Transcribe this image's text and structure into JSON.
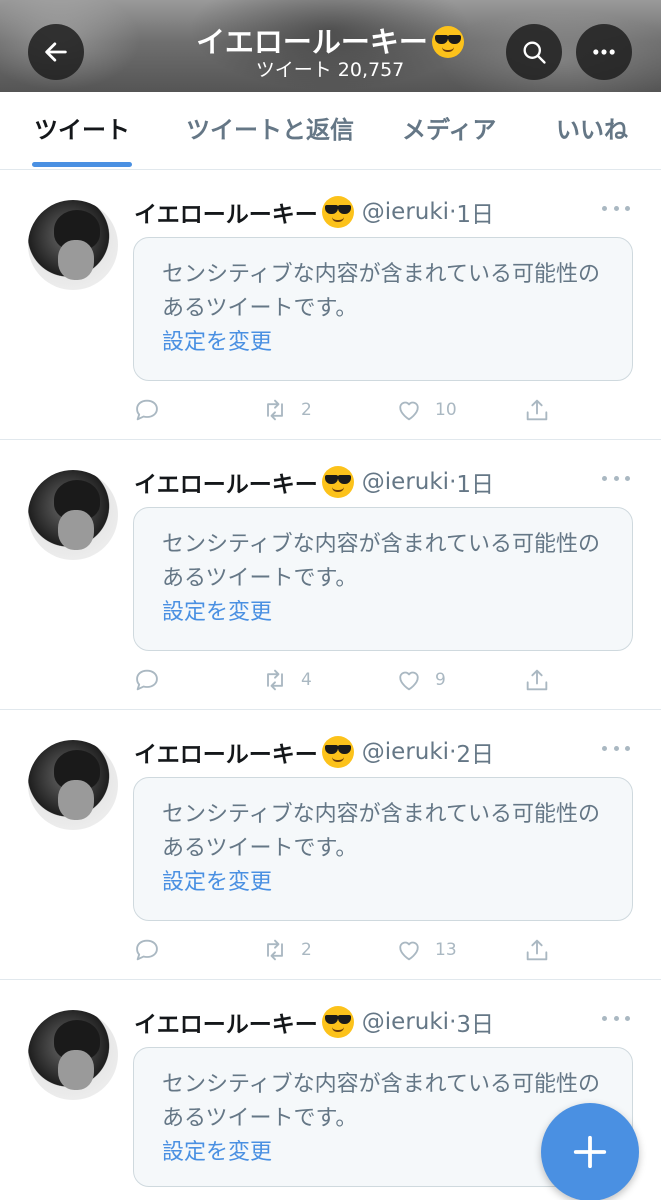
{
  "header": {
    "title": "イエロールーキー",
    "subtitle": "ツイート 20,757",
    "icons": [
      "back-arrow-icon",
      "search-icon",
      "more-icon"
    ]
  },
  "tabs": [
    {
      "label": "ツイート",
      "active": true
    },
    {
      "label": "ツイートと返信",
      "active": false
    },
    {
      "label": "メディア",
      "active": false
    },
    {
      "label": "いいね",
      "active": false
    }
  ],
  "tweets": [
    {
      "name": "イエロールーキー",
      "handle": "@ieruki",
      "time": "1日",
      "sensitive_text": "センシティブな内容が含まれている可能性のあるツイートです。",
      "link": "設定を変更",
      "retweets": "2",
      "likes": "10"
    },
    {
      "name": "イエロールーキー",
      "handle": "@ieruki",
      "time": "1日",
      "sensitive_text": "センシティブな内容が含まれている可能性のあるツイートです。",
      "link": "設定を変更",
      "retweets": "4",
      "likes": "9"
    },
    {
      "name": "イエロールーキー",
      "handle": "@ieruki",
      "time": "2日",
      "sensitive_text": "センシティブな内容が含まれている可能性のあるツイートです。",
      "link": "設定を変更",
      "retweets": "2",
      "likes": "13"
    },
    {
      "name": "イエロールーキー",
      "handle": "@ieruki",
      "time": "3日",
      "sensitive_text": "センシティブな内容が含まれている可能性のあるツイートです。",
      "link": "設定を変更",
      "retweets": "",
      "likes": ""
    }
  ],
  "colors": {
    "accent": "#4a90e2",
    "muted": "#657786",
    "border": "#e1e8ed"
  },
  "fab": {
    "icon": "plus-icon"
  }
}
